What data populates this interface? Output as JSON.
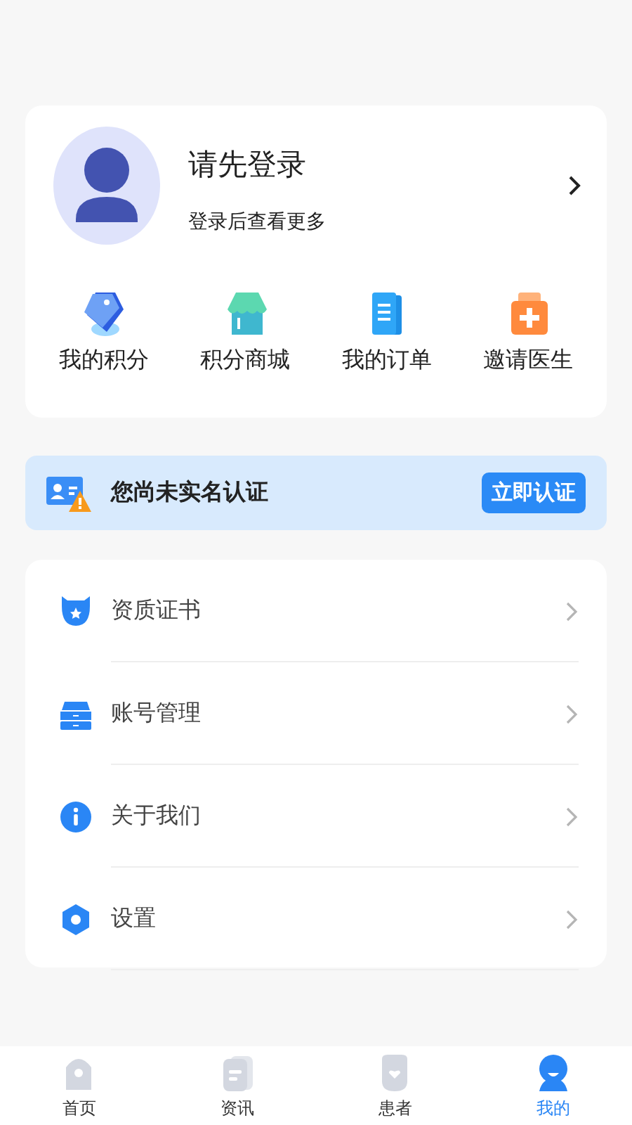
{
  "profile": {
    "title": "请先登录",
    "subtitle": "登录后查看更多"
  },
  "shortcuts": [
    {
      "kind": "points",
      "label": "我的积分"
    },
    {
      "kind": "mall",
      "label": "积分商城"
    },
    {
      "kind": "orders",
      "label": "我的订单"
    },
    {
      "kind": "invite",
      "label": "邀请医生"
    }
  ],
  "verify_banner": {
    "message": "您尚未实名认证",
    "button": "立即认证"
  },
  "menu": [
    {
      "kind": "certificate",
      "label": "资质证书"
    },
    {
      "kind": "account",
      "label": "账号管理"
    },
    {
      "kind": "about",
      "label": "关于我们"
    },
    {
      "kind": "settings",
      "label": "设置"
    }
  ],
  "tabs": [
    {
      "kind": "home",
      "label": "首页",
      "selected": false
    },
    {
      "kind": "news",
      "label": "资讯",
      "selected": false
    },
    {
      "kind": "patients",
      "label": "患者",
      "selected": false
    },
    {
      "kind": "mine",
      "label": "我的",
      "selected": true
    }
  ]
}
